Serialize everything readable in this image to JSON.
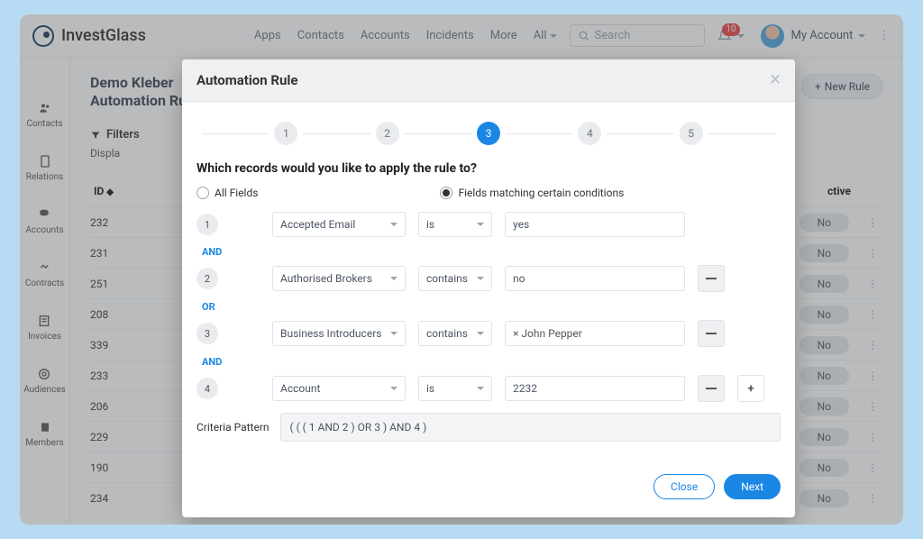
{
  "brand": "InvestGlass",
  "nav": {
    "links": [
      "Apps",
      "Contacts",
      "Accounts",
      "Incidents",
      "More"
    ],
    "all_label": "All",
    "search_placeholder": "Search",
    "notification_count": "10",
    "account_label": "My Account"
  },
  "page": {
    "title_line1": "Demo Kleber",
    "title_line2": "Automation Rule",
    "new_rule_label": "New Rule",
    "filters_label": "Filters",
    "display_label": "Displa",
    "col_id": "ID",
    "col_active": "ctive"
  },
  "rail": [
    "Contacts",
    "Relations",
    "Accounts",
    "Contracts",
    "Invoices",
    "Audiences",
    "Members"
  ],
  "rows": [
    {
      "id": "232",
      "active": "No"
    },
    {
      "id": "231",
      "active": "No"
    },
    {
      "id": "251",
      "active": "No"
    },
    {
      "id": "208",
      "active": "No"
    },
    {
      "id": "339",
      "active": "No"
    },
    {
      "id": "233",
      "active": "No"
    },
    {
      "id": "206",
      "active": "No"
    },
    {
      "id": "229",
      "active": "No"
    },
    {
      "id": "190",
      "active": "No"
    },
    {
      "id": "234",
      "active": "No"
    }
  ],
  "modal": {
    "title": "Automation Rule",
    "steps": [
      "1",
      "2",
      "3",
      "4",
      "5"
    ],
    "active_step": 3,
    "question": "Which records would you like to apply the rule to?",
    "radio_all": "All Fields",
    "radio_cond": "Fields matching certain conditions",
    "conditions": [
      {
        "n": "1",
        "field": "Accepted Email",
        "op": "is",
        "value": "yes",
        "can_remove": false
      },
      {
        "logic": "AND"
      },
      {
        "n": "2",
        "field": "Authorised Brokers",
        "op": "contains",
        "value": "no",
        "can_remove": true
      },
      {
        "logic": "OR"
      },
      {
        "n": "3",
        "field": "Business Introducers",
        "op": "contains",
        "tag": "John Pepper",
        "can_remove": true
      },
      {
        "logic": "AND"
      },
      {
        "n": "4",
        "field": "Account",
        "op": "is",
        "value": "2232",
        "can_remove": true,
        "can_add": true
      }
    ],
    "criteria_label": "Criteria Pattern",
    "criteria_value": "( ( ( 1 AND 2 ) OR 3 ) AND 4 )",
    "close_label": "Close",
    "next_label": "Next"
  }
}
